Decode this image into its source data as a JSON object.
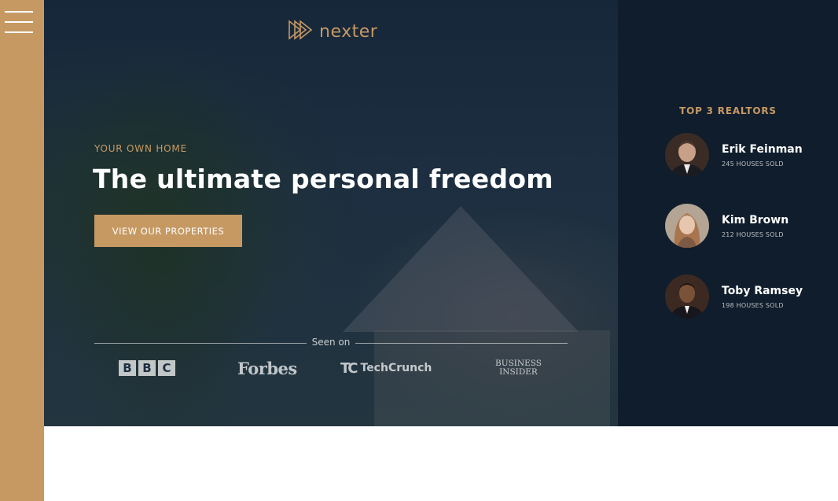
{
  "sidebar": {
    "nav_icon": "menu-icon"
  },
  "header": {
    "logo_text": "nexter",
    "logo_icon": "play-triangles-icon",
    "subtitle": "Your own home",
    "heading": "The ultimate personal freedom",
    "cta_label": "View our properties",
    "seen_on": "Seen on",
    "press": {
      "bbc": [
        "B",
        "B",
        "C"
      ],
      "forbes": "Forbes",
      "techcrunch_mark": "TC",
      "techcrunch": "TechCrunch",
      "bi_line1": "BUSINESS",
      "bi_line2": "INSIDER"
    }
  },
  "realtors": {
    "title": "Top 3 Realtors",
    "items": [
      {
        "name": "Erik Feinman",
        "sold": "245 Houses Sold"
      },
      {
        "name": "Kim Brown",
        "sold": "212 Houses Sold"
      },
      {
        "name": "Toby Ramsey",
        "sold": "198 Houses Sold"
      }
    ]
  },
  "colors": {
    "accent": "#c69963",
    "dark_panel": "#101d2c",
    "header_overlay": "#1c2e40"
  }
}
